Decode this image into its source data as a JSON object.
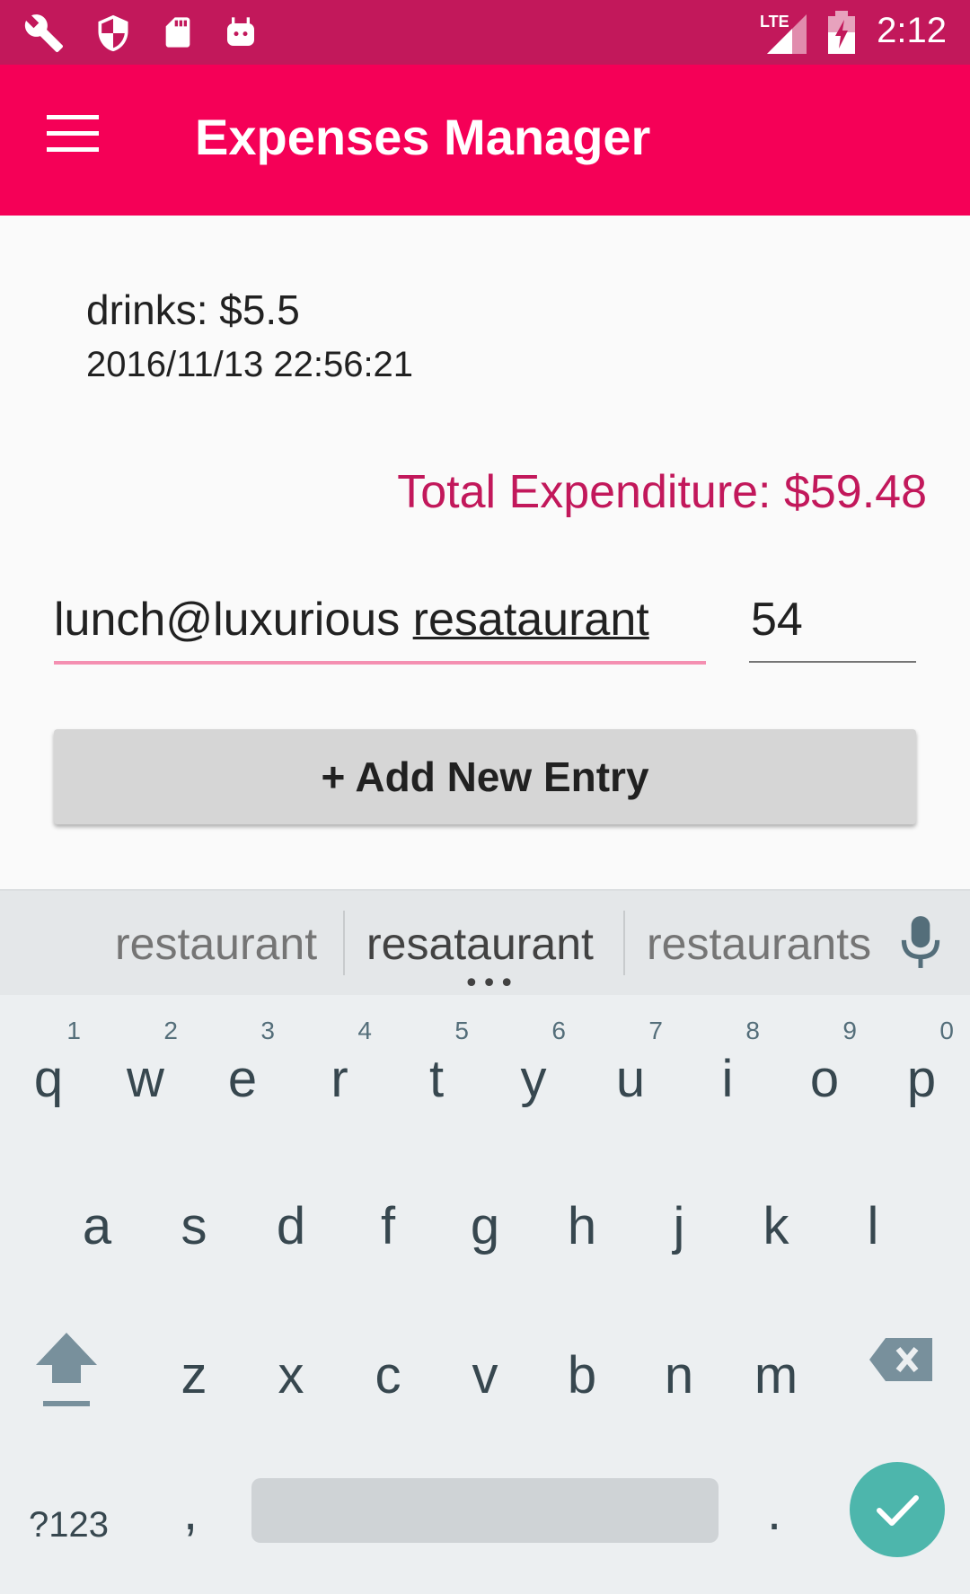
{
  "status_bar": {
    "time": "2:12",
    "network": "LTE",
    "icons": [
      "wrench-icon",
      "shield-icon",
      "sd-card-icon",
      "android-icon",
      "signal-icon",
      "battery-icon"
    ]
  },
  "app_bar": {
    "title": "Expenses Manager",
    "menu_icon": "menu-icon"
  },
  "entries": [
    {
      "label": "drinks: $5.5",
      "timestamp": "2016/11/13 22:56:21"
    }
  ],
  "total_label": "Total Expenditure: $59.48",
  "form": {
    "description_value_prefix": "lunch@luxurious ",
    "description_value_composing": "resataurant",
    "amount_value": "54",
    "add_button_label": "+ Add New Entry"
  },
  "keyboard": {
    "suggestions": [
      "restaurant",
      "resataurant",
      "restaurants"
    ],
    "suggestion_more": "•••",
    "row1": [
      {
        "ch": "q",
        "num": "1"
      },
      {
        "ch": "w",
        "num": "2"
      },
      {
        "ch": "e",
        "num": "3"
      },
      {
        "ch": "r",
        "num": "4"
      },
      {
        "ch": "t",
        "num": "5"
      },
      {
        "ch": "y",
        "num": "6"
      },
      {
        "ch": "u",
        "num": "7"
      },
      {
        "ch": "i",
        "num": "8"
      },
      {
        "ch": "o",
        "num": "9"
      },
      {
        "ch": "p",
        "num": "0"
      }
    ],
    "row2": [
      "a",
      "s",
      "d",
      "f",
      "g",
      "h",
      "j",
      "k",
      "l"
    ],
    "row3": [
      "z",
      "x",
      "c",
      "v",
      "b",
      "n",
      "m"
    ],
    "symbols_label": "?123",
    "comma": ",",
    "period": ".",
    "colors": {
      "accent": "#4db6ac",
      "background": "#eceff1"
    }
  },
  "colors": {
    "status_bar": "#c2185b",
    "app_bar": "#f50057",
    "total_text": "#c2185b",
    "focused_underline": "#f48fb1"
  }
}
